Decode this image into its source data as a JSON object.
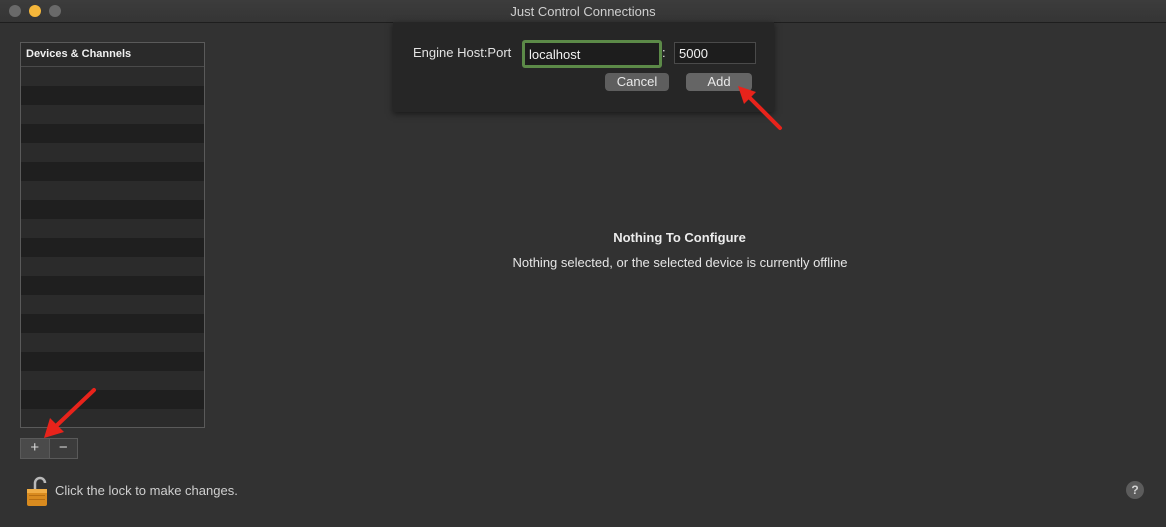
{
  "window": {
    "title": "Just Control Connections"
  },
  "sidebar": {
    "header": "Devices & Channels",
    "add_label": "+",
    "remove_label": "−"
  },
  "lock": {
    "text": "Click the lock to make changes."
  },
  "help": {
    "label": "?"
  },
  "sheet": {
    "host_label": "Engine Host:Port",
    "host_value": "localhost",
    "separator": ":",
    "port_value": "5000",
    "cancel_label": "Cancel",
    "add_label": "Add"
  },
  "main": {
    "empty_title": "Nothing To Configure",
    "empty_subtitle": "Nothing selected, or the selected device is currently offline"
  },
  "colors": {
    "focus_ring": "#5c8a48",
    "annotation_arrow": "#e8231b",
    "minimize_button": "#f5b73b"
  }
}
